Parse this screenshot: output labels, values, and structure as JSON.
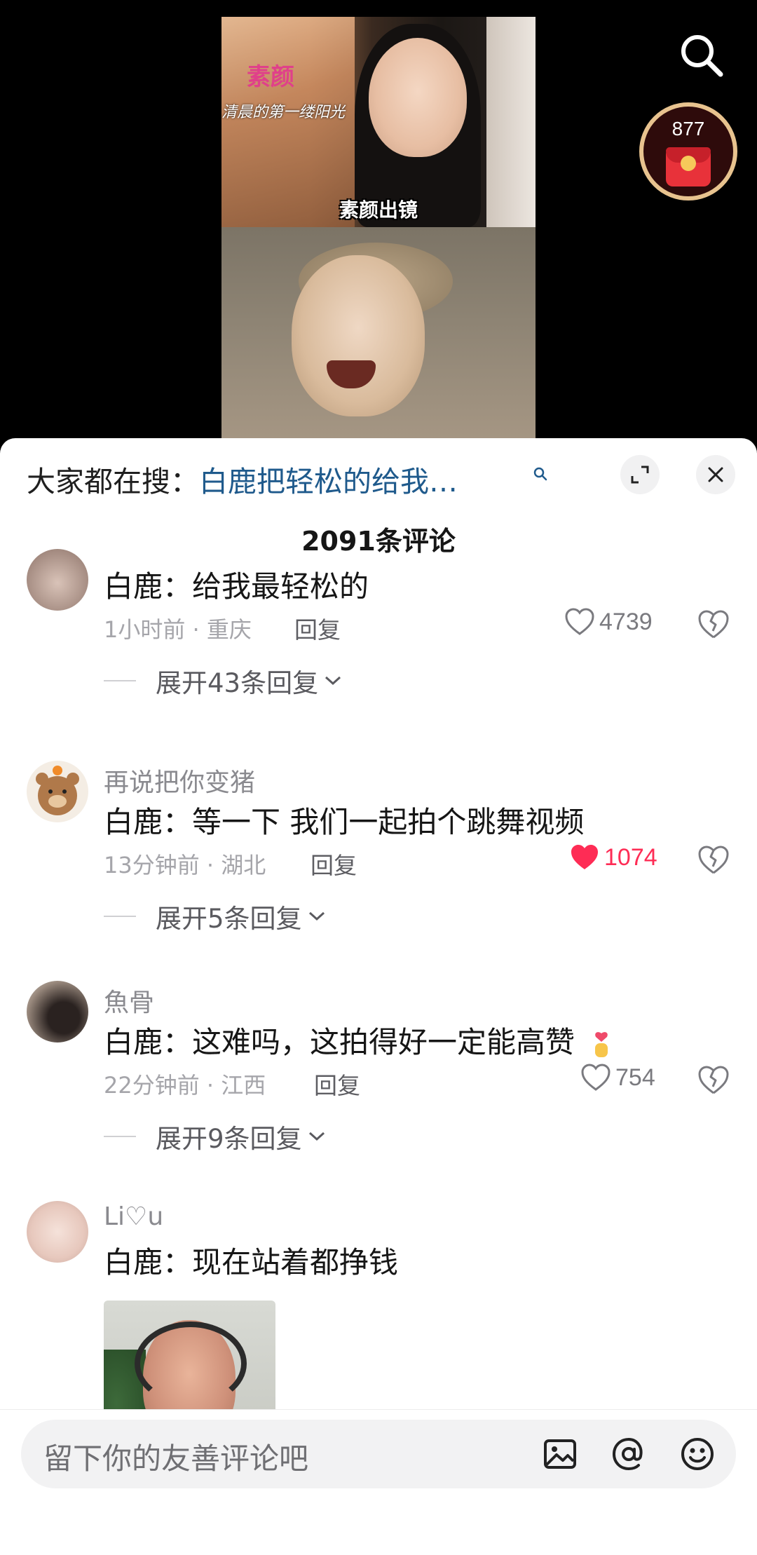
{
  "video": {
    "caption_top_title": "素颜",
    "caption_top_sub": "清晨的第一缕阳光",
    "caption_overlay": "素颜出镜",
    "redpacket_count": "877"
  },
  "sheet": {
    "hot_search_prefix": "大家都在搜：",
    "hot_search_query": "白鹿把轻松的给我…",
    "comment_count": "2091条评论"
  },
  "comments": [
    {
      "nickname": "",
      "text": "白鹿：给我最轻松的",
      "time_location": "1小时前 · 重庆",
      "reply_label": "回复",
      "likes": "4739",
      "liked": false,
      "expand_label": "展开43条回复"
    },
    {
      "nickname": "再说把你变猪",
      "text": "白鹿：等一下 我们一起拍个跳舞视频",
      "time_location": "13分钟前 · 湖北",
      "reply_label": "回复",
      "likes": "1074",
      "liked": true,
      "expand_label": "展开5条回复"
    },
    {
      "nickname": "魚骨",
      "text": "白鹿：这难吗，这拍得好一定能高赞",
      "emoji": "finger-heart",
      "time_location": "22分钟前 · 江西",
      "reply_label": "回复",
      "likes": "754",
      "liked": false,
      "expand_label": "展开9条回复"
    },
    {
      "nickname": "Li♡u",
      "text": "白鹿：现在站着都挣钱",
      "has_image": true
    }
  ],
  "input": {
    "placeholder": "留下你的友善评论吧",
    "icons": [
      "image-icon",
      "at-icon",
      "emoji-icon"
    ]
  },
  "colors": {
    "accent_like": "#fe2c55",
    "hot_search_link": "#1f5a8c",
    "redpacket": "#e8323a"
  }
}
